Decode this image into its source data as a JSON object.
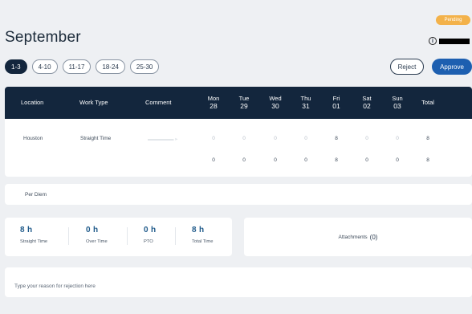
{
  "status_badge": "Pending",
  "month_title": "September",
  "info_icon": "info-circle-icon",
  "weeks": [
    "1-3",
    "4-10",
    "11-17",
    "18-24",
    "25-30"
  ],
  "buttons": {
    "reject": "Reject",
    "approve": "Approve"
  },
  "columns": {
    "location": "Location",
    "work_type": "Work Type",
    "comment": "Comment",
    "days": [
      {
        "day": "Mon",
        "date": "28"
      },
      {
        "day": "Tue",
        "date": "29"
      },
      {
        "day": "Wed",
        "date": "30"
      },
      {
        "day": "Thu",
        "date": "31"
      },
      {
        "day": "Fri",
        "date": "01"
      },
      {
        "day": "Sat",
        "date": "02"
      },
      {
        "day": "Sun",
        "date": "03"
      }
    ],
    "total": "Total"
  },
  "row": {
    "location": "Houston",
    "work_type": "Straight Time",
    "hours": [
      "0",
      "0",
      "0",
      "0",
      "8",
      "0",
      "0"
    ],
    "total": "8"
  },
  "totals_row": {
    "hours": [
      "0",
      "0",
      "0",
      "0",
      "8",
      "0",
      "0"
    ],
    "total": "8"
  },
  "per_diem_label": "Per Diem",
  "summary": [
    {
      "value": "8 h",
      "label": "Straight Time"
    },
    {
      "value": "0 h",
      "label": "Over Time"
    },
    {
      "value": "0 h",
      "label": "PTO"
    },
    {
      "value": "8 h",
      "label": "Total Time"
    }
  ],
  "attachments": {
    "label": "Attachments",
    "count": "(0)"
  },
  "rejection": {
    "placeholder": "Type your reason for rejection here",
    "value": ""
  },
  "colors": {
    "header_bg": "#13263d",
    "accent_blue": "#1d5fb0",
    "badge_orange": "#f3b24a",
    "summary_value": "#1f5a8a"
  }
}
